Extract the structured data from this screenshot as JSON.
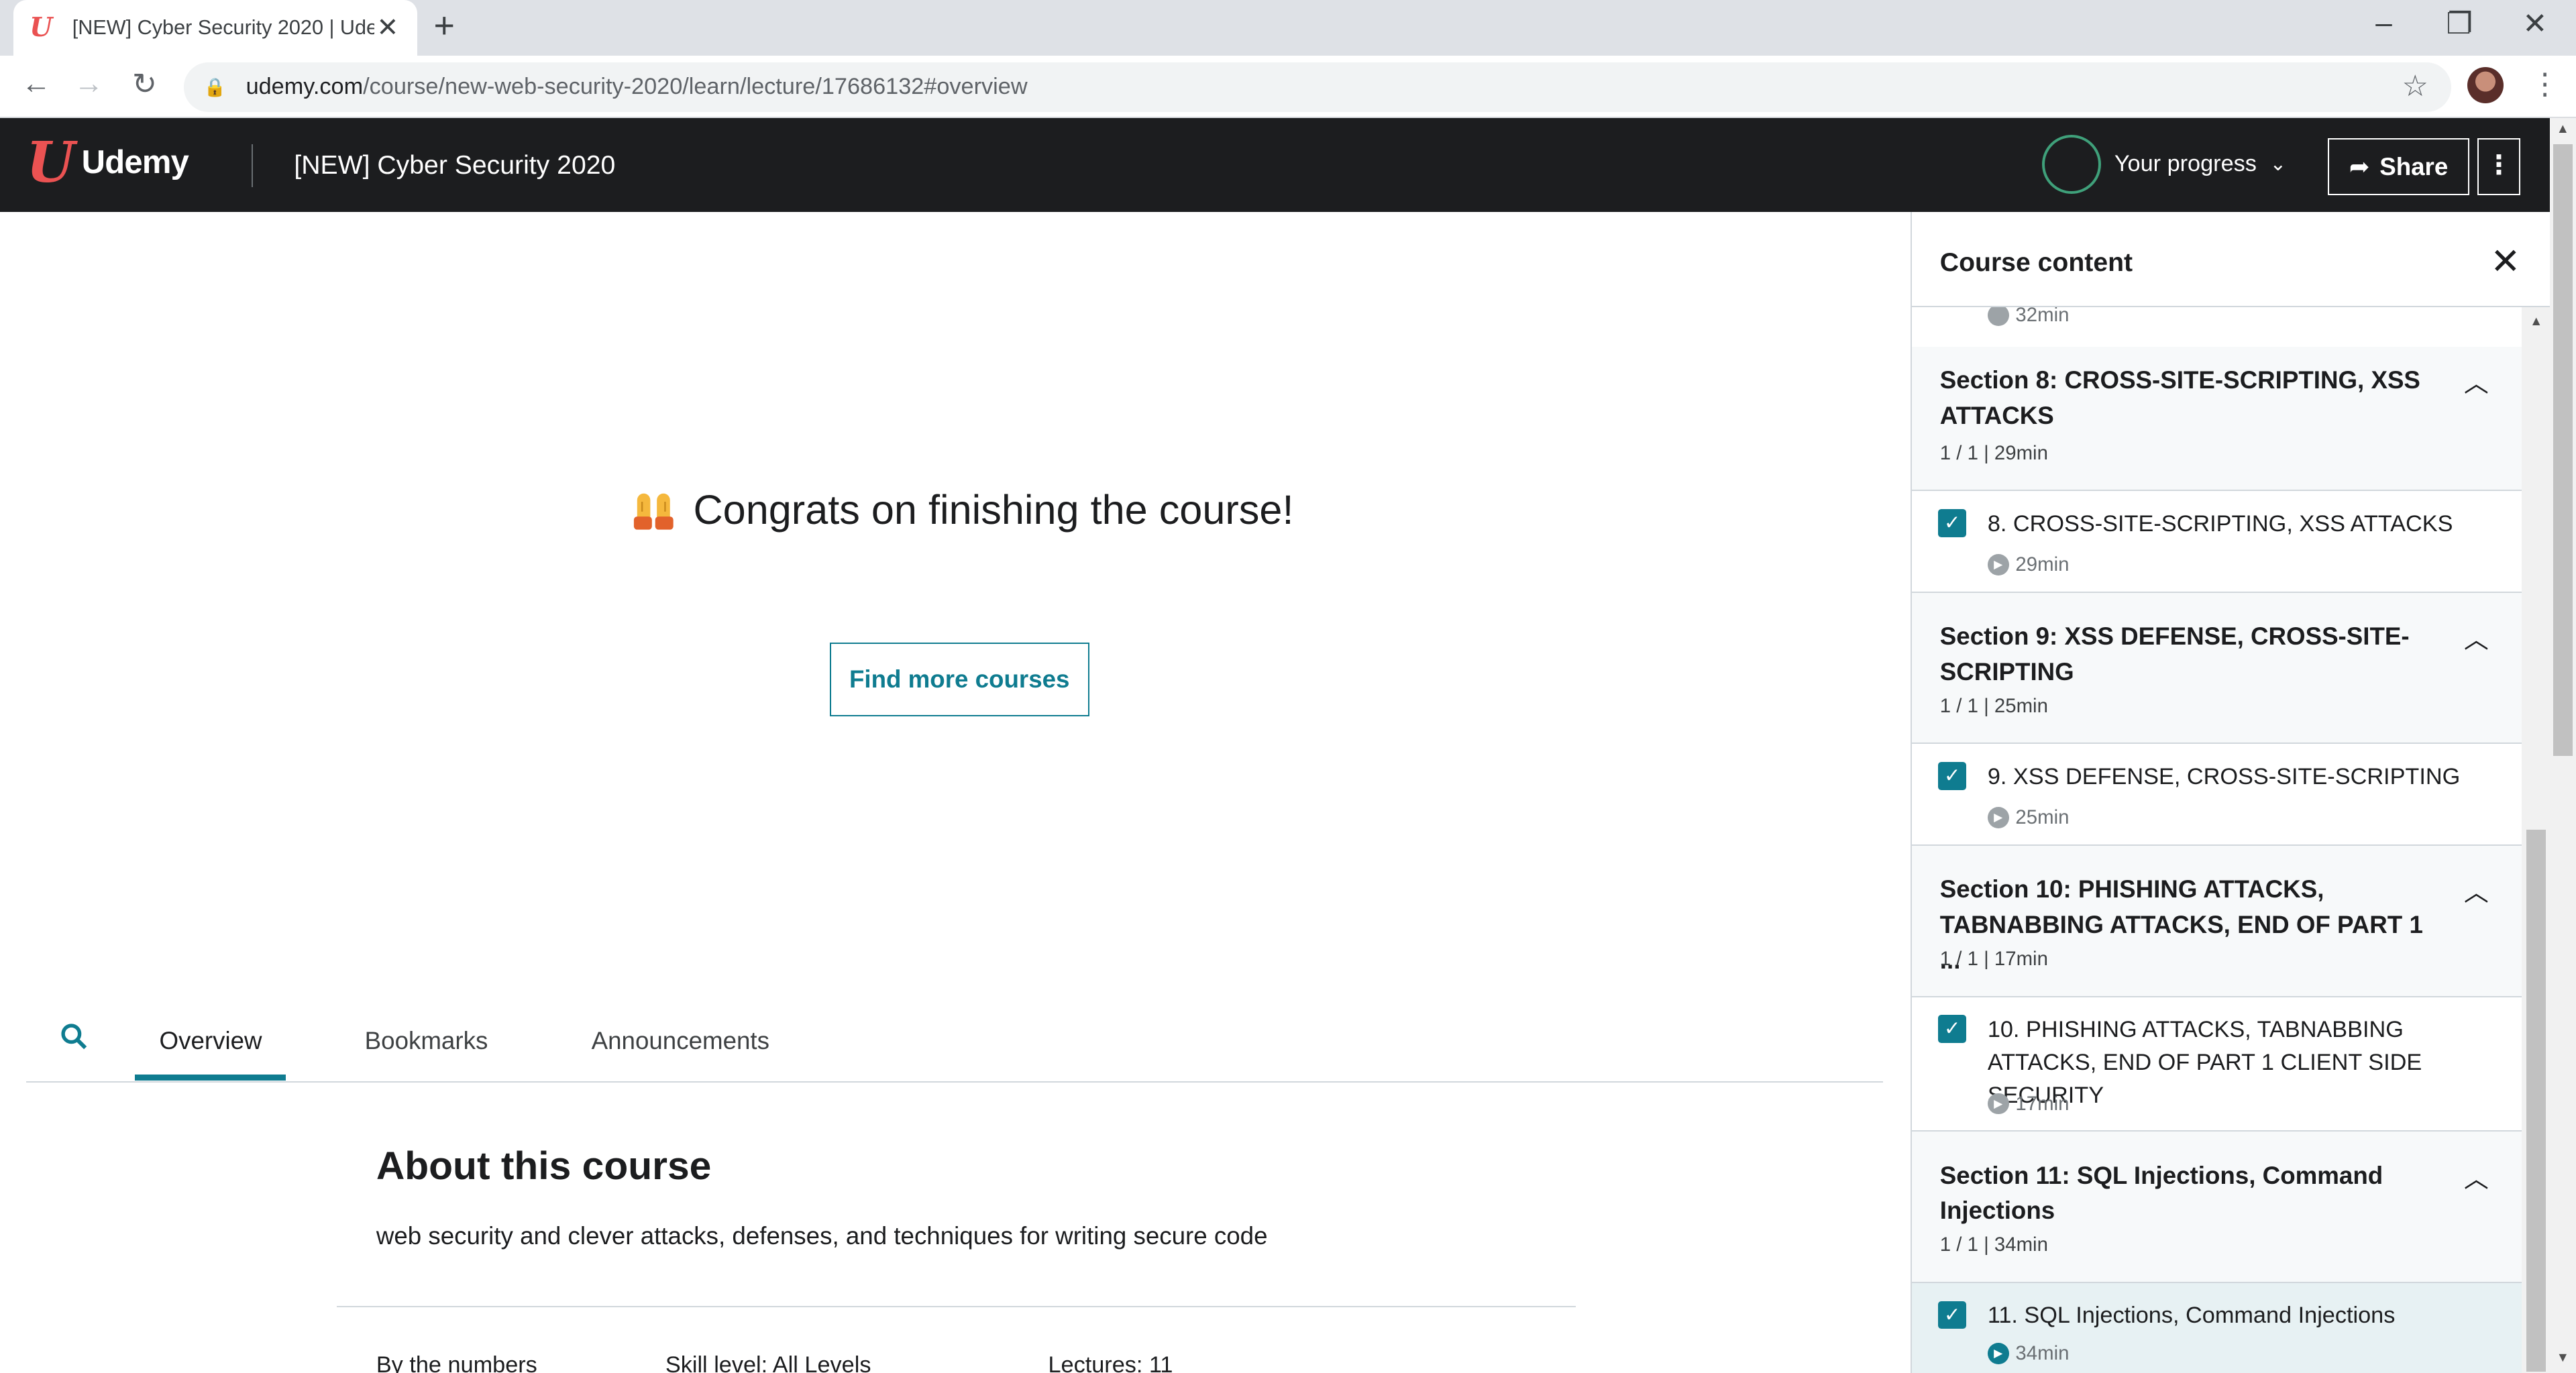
{
  "browser": {
    "tab_title": "[NEW] Cyber Security 2020 | Udemy",
    "tab_favicon": "U",
    "url_domain": "udemy.com",
    "url_path": "/course/new-web-security-2020/learn/lecture/17686132#overview"
  },
  "header": {
    "logo_mark": "U",
    "logo_text": "Udemy",
    "course_title": "[NEW] Cyber Security 2020",
    "progress_label": "Your progress",
    "share_label": "Share",
    "more_label": "⋮"
  },
  "main": {
    "congrats_text": "Congrats on finishing the course!",
    "find_more_label": "Find more courses",
    "tabs": [
      {
        "label": "Overview"
      },
      {
        "label": "Bookmarks"
      },
      {
        "label": "Announcements"
      }
    ],
    "about_title": "About this course",
    "about_desc": "web security and clever attacks, defenses, and techniques for writing secure code",
    "stats": [
      "By the numbers",
      "Skill level: All Levels",
      "Lectures: 11"
    ]
  },
  "sidebar": {
    "title": "Course content",
    "top_duration": "32min",
    "sections": [
      {
        "title": "Section 8: CROSS-SITE-SCRIPTING, XSS ATTACKS",
        "meta": "1 / 1 | 29min",
        "lecture": "8. CROSS-SITE-SCRIPTING, XSS ATTACKS",
        "duration": "29min"
      },
      {
        "title": "Section 9: XSS DEFENSE, CROSS-SITE-SCRIPTING",
        "meta": "1 / 1 | 25min",
        "lecture": "9. XSS DEFENSE, CROSS-SITE-SCRIPTING",
        "duration": "25min"
      },
      {
        "title": "Section 10: PHISHING ATTACKS, TABNABBING ATTACKS, END OF PART 1 ...",
        "meta": "1 / 1 | 17min",
        "lecture": "10. PHISHING ATTACKS, TABNABBING ATTACKS, END OF PART 1 CLIENT SIDE SECURITY",
        "duration": "17min"
      },
      {
        "title": "Section 11: SQL Injections, Command Injections",
        "meta": "1 / 1 | 34min",
        "lecture": "11. SQL Injections, Command Injections",
        "duration": "34min"
      }
    ]
  },
  "colors": {
    "accent": "#0f7c90",
    "header_bg": "#1c1d1f",
    "brand": "#ea5252",
    "progress_ring": "#3fa07a"
  }
}
